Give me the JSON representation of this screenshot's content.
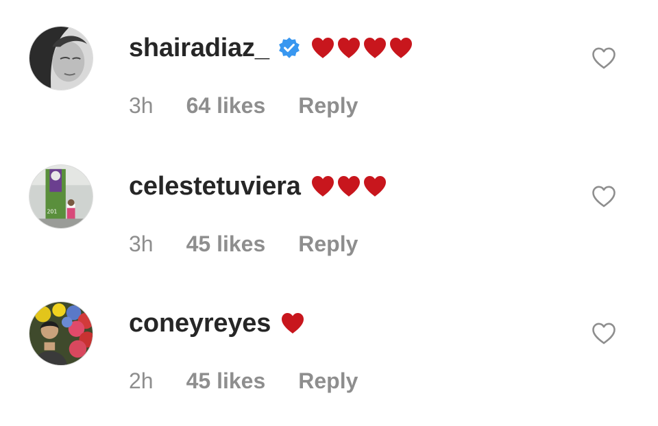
{
  "colors": {
    "username": "#262626",
    "meta": "#8e8e8e",
    "heart_emoji": "#c8161d",
    "verified_badge": "#3897f0",
    "like_outline": "#8e8e8e"
  },
  "comments": [
    {
      "username": "shairadiaz_",
      "verified": true,
      "emoji": "red-heart-emoji",
      "emoji_count": 4,
      "time": "3h",
      "likes": "64 likes",
      "reply_label": "Reply",
      "like_icon": "heart-outline-icon"
    },
    {
      "username": "celestetuviera",
      "verified": false,
      "emoji": "red-heart-emoji",
      "emoji_count": 3,
      "time": "3h",
      "likes": "45 likes",
      "reply_label": "Reply",
      "like_icon": "heart-outline-icon"
    },
    {
      "username": "coneyreyes",
      "verified": false,
      "emoji": "red-heart-emoji",
      "emoji_count": 1,
      "time": "2h",
      "likes": "45 likes",
      "reply_label": "Reply",
      "like_icon": "heart-outline-icon"
    }
  ]
}
